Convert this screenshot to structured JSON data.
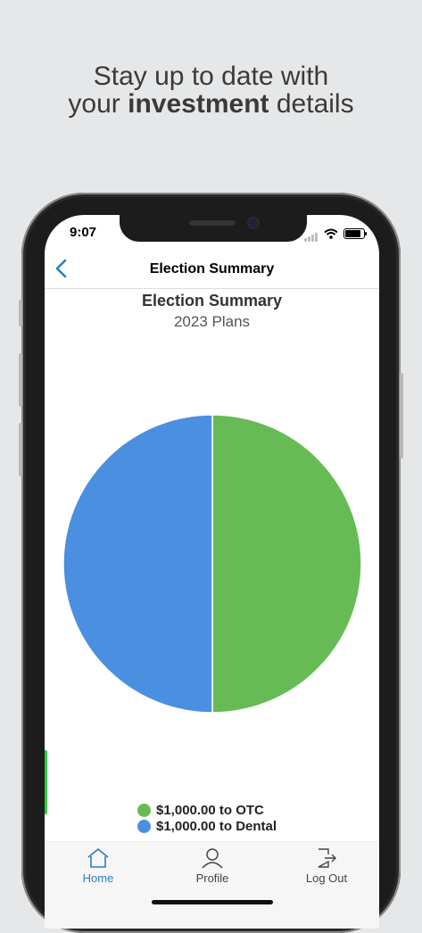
{
  "promo": {
    "line1": "Stay up to date with",
    "line2_pre": "your",
    "line2_bold": "investment",
    "line2_post": "details"
  },
  "status_bar": {
    "time": "9:07",
    "icons": [
      "signal-icon",
      "wifi-icon",
      "battery-icon"
    ]
  },
  "navbar": {
    "title": "Election Summary",
    "back_icon": "chevron-left-icon"
  },
  "chart_data": {
    "type": "pie",
    "title": "Election Summary",
    "subtitle": "2023 Plans",
    "series": [
      {
        "name": "$1,000.00 to OTC",
        "value": 1000,
        "color": "#66bb55"
      },
      {
        "name": "$1,000.00 to Dental",
        "value": 1000,
        "color": "#4a8fe0"
      }
    ],
    "legend_placement": "bottom"
  },
  "tabs": [
    {
      "label": "Home",
      "icon": "home-icon",
      "active": true
    },
    {
      "label": "Profile",
      "icon": "person-icon",
      "active": false
    },
    {
      "label": "Log Out",
      "icon": "logout-icon",
      "active": false
    }
  ],
  "colors": {
    "accent": "#2a7fbd",
    "background": "#e6e7e8"
  }
}
